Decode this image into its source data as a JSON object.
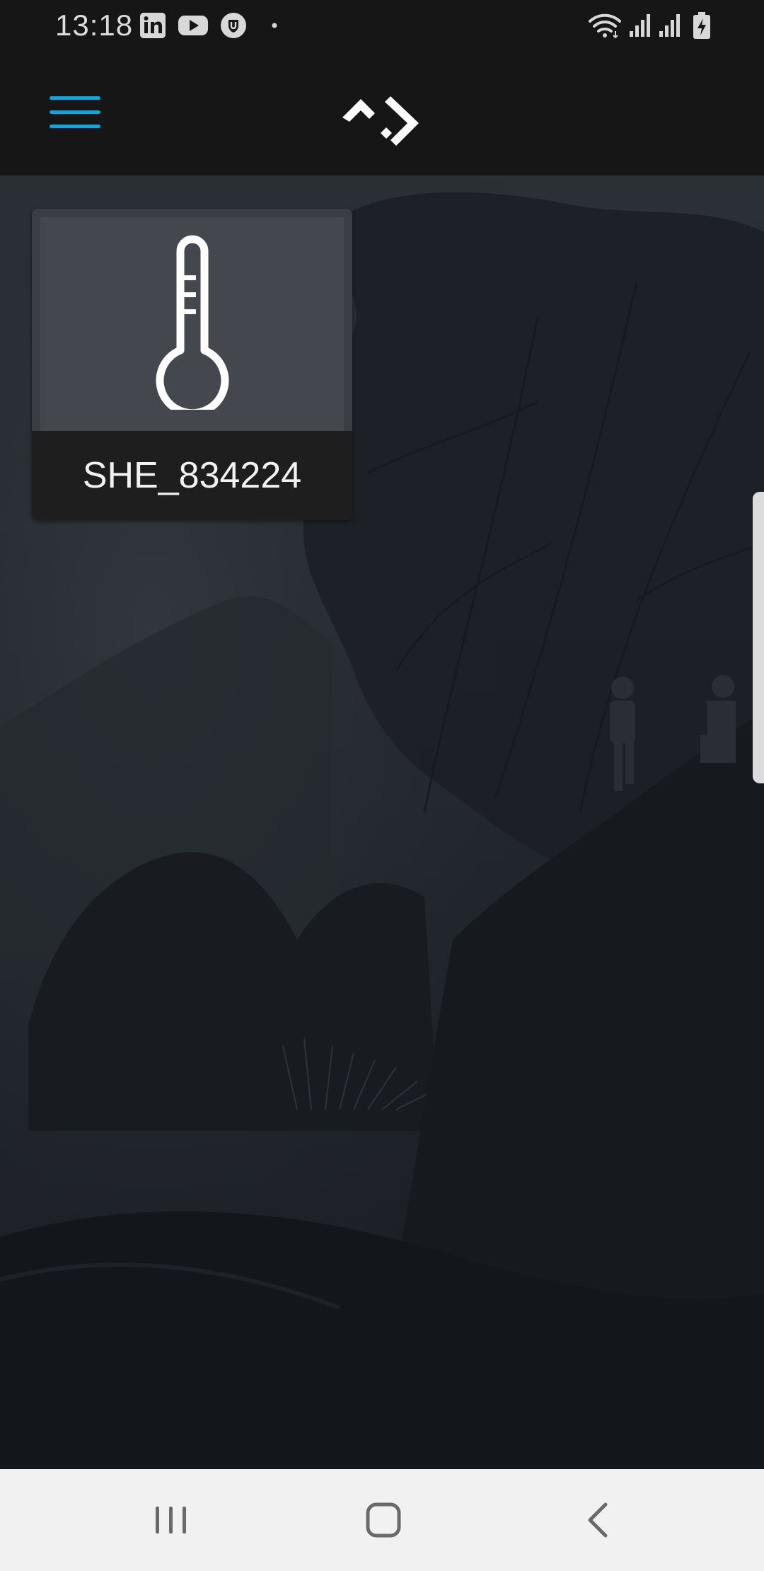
{
  "status_bar": {
    "time": "13:18",
    "left_icons": [
      "linkedin-icon",
      "youtube-icon",
      "shield-app-icon",
      "dot-icon"
    ],
    "right_icons": [
      "wifi-icon",
      "signal-icon",
      "signal-icon",
      "battery-charging-icon"
    ]
  },
  "app_bar": {
    "menu_icon": "hamburger-menu-icon",
    "logo_icon": "brand-logo-icon",
    "accent_color": "#14a5d6"
  },
  "devices": [
    {
      "name": "SHE_834224",
      "icon": "thermometer-icon"
    }
  ],
  "nav_bar": {
    "recents_icon": "recents-icon",
    "home_icon": "home-icon",
    "back_icon": "back-icon"
  }
}
